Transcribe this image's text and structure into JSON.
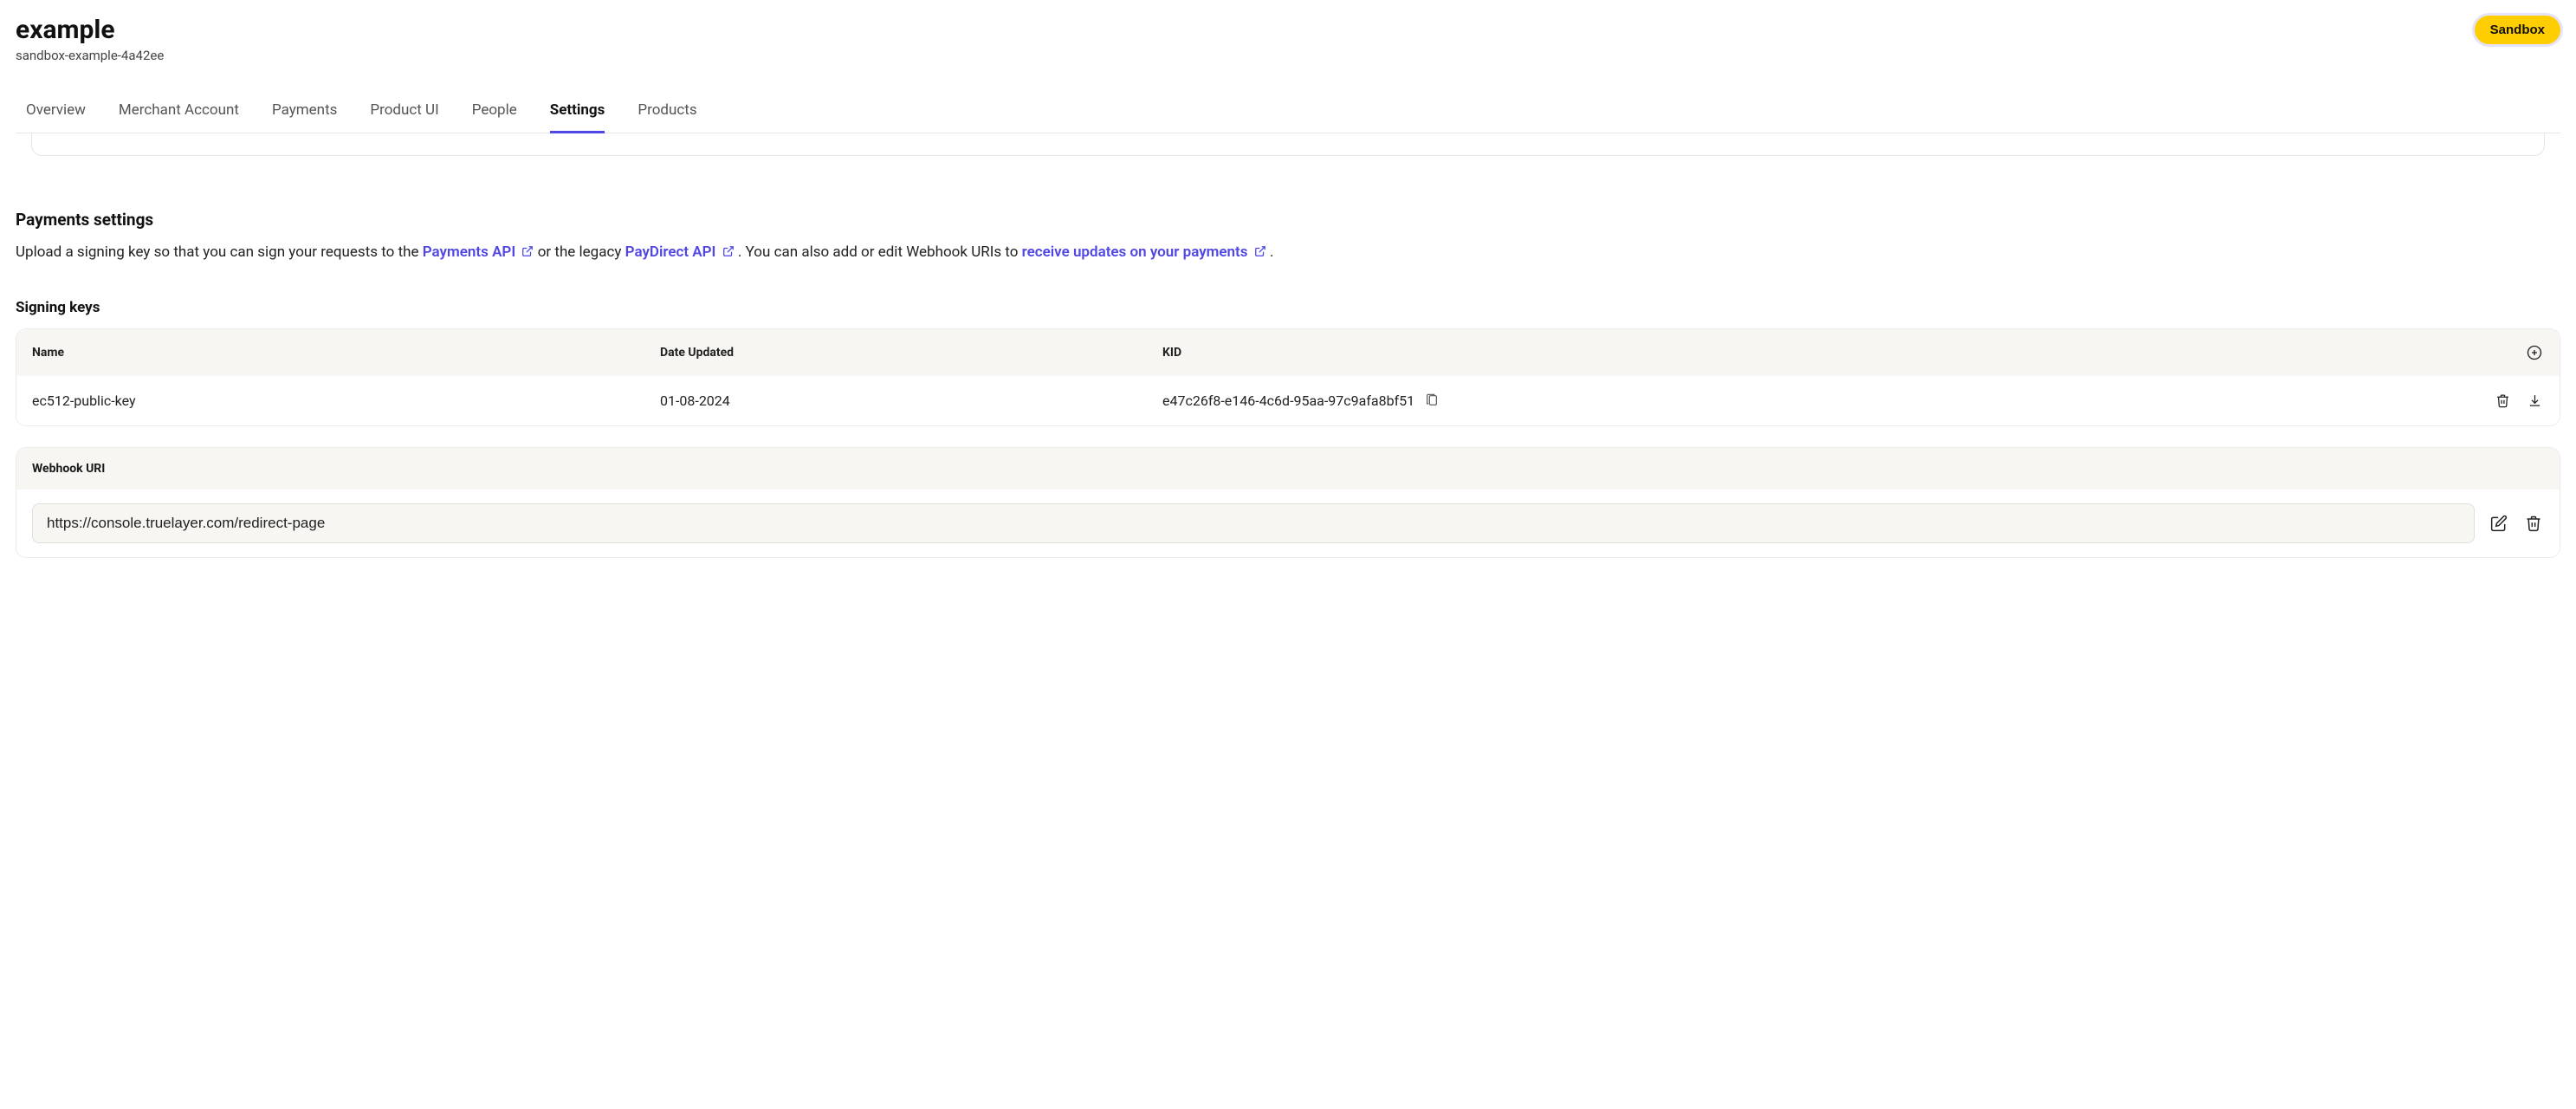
{
  "header": {
    "title": "example",
    "subtitle": "sandbox-example-4a42ee",
    "badge": "Sandbox"
  },
  "tabs": [
    {
      "label": "Overview",
      "active": false
    },
    {
      "label": "Merchant Account",
      "active": false
    },
    {
      "label": "Payments",
      "active": false
    },
    {
      "label": "Product UI",
      "active": false
    },
    {
      "label": "People",
      "active": false
    },
    {
      "label": "Settings",
      "active": true
    },
    {
      "label": "Products",
      "active": false
    }
  ],
  "payments_settings": {
    "title": "Payments settings",
    "desc_prefix": "Upload a signing key so that you can sign your requests to the ",
    "link1": "Payments API",
    "mid1": " or the legacy ",
    "link2": "PayDirect API",
    "mid2": ". You can also add or edit Webhook URIs to ",
    "link3": "receive updates on your payments",
    "suffix": "."
  },
  "signing_keys": {
    "title": "Signing keys",
    "columns": {
      "name": "Name",
      "date": "Date Updated",
      "kid": "KID"
    },
    "rows": [
      {
        "name": "ec512-public-key",
        "date": "01-08-2024",
        "kid": "e47c26f8-e146-4c6d-95aa-97c9afa8bf51"
      }
    ]
  },
  "webhook": {
    "title": "Webhook URI",
    "value": "https://console.truelayer.com/redirect-page"
  }
}
